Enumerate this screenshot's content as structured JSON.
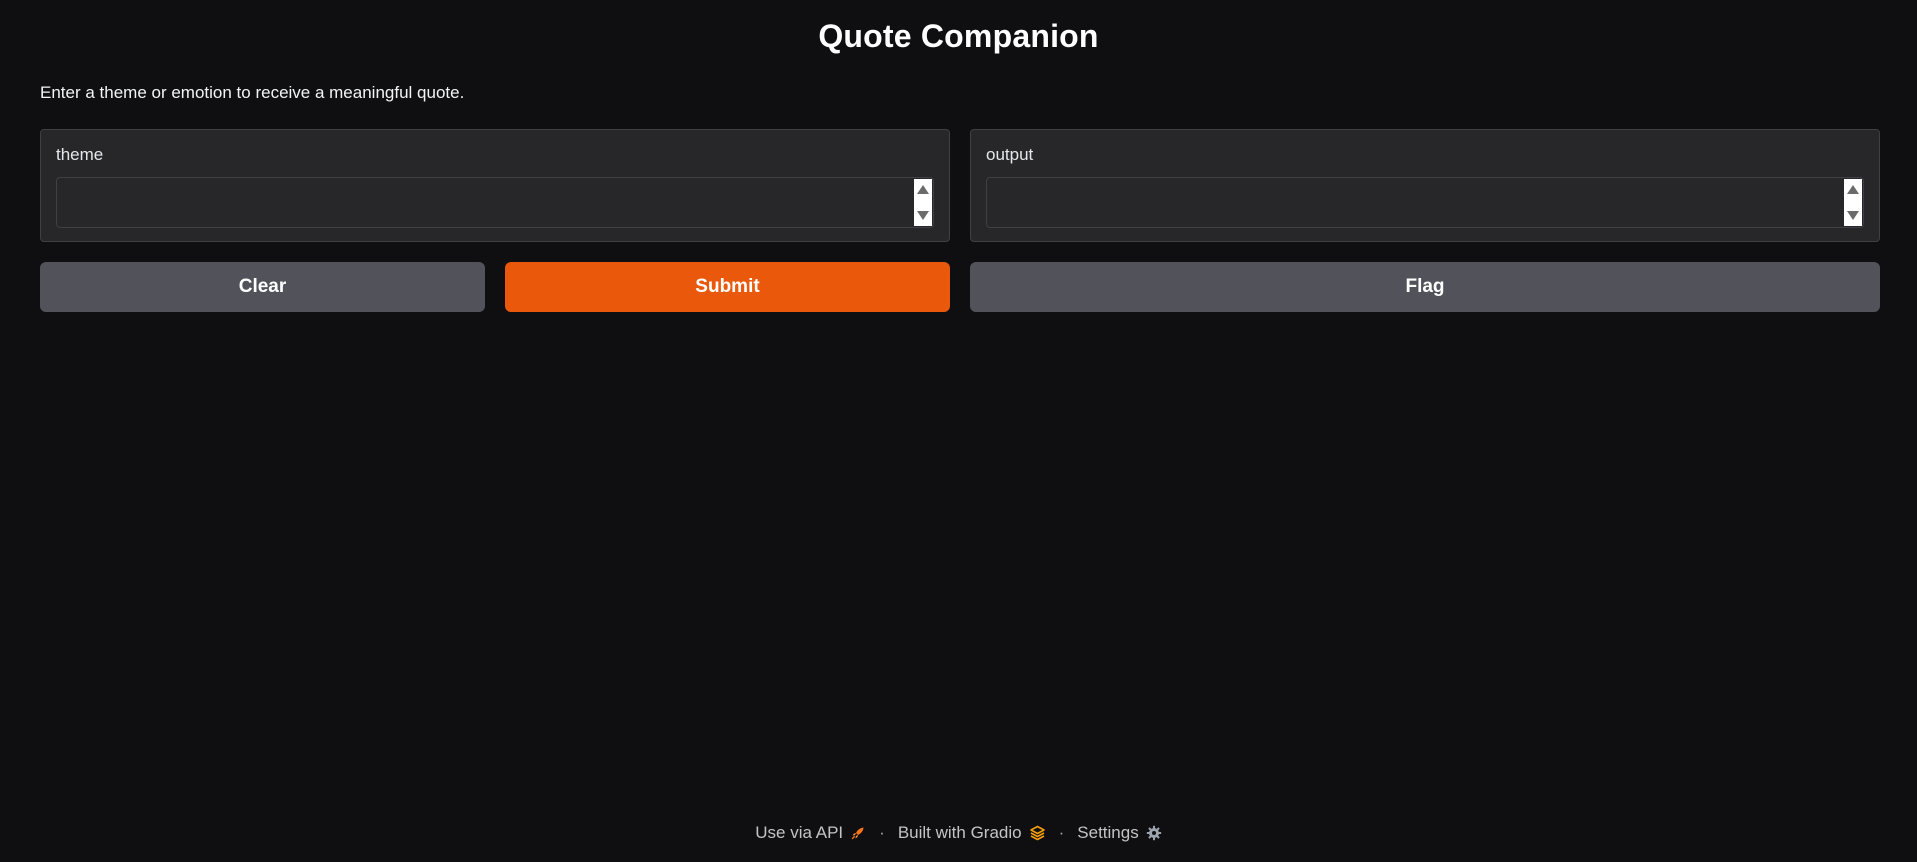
{
  "header": {
    "title": "Quote Companion",
    "description": "Enter a theme or emotion to receive a meaningful quote."
  },
  "inputs": {
    "theme": {
      "label": "theme",
      "value": ""
    },
    "output": {
      "label": "output",
      "value": ""
    }
  },
  "buttons": {
    "clear": "Clear",
    "submit": "Submit",
    "flag": "Flag"
  },
  "footer": {
    "api": "Use via API",
    "built": "Built with Gradio",
    "settings": "Settings",
    "separator": "·"
  },
  "colors": {
    "background": "#0f0f11",
    "panel": "#27272a",
    "primary": "#ea580c",
    "secondary": "#52525b"
  },
  "icons": {
    "api": "rocket-icon",
    "gradio": "gradio-logo-icon",
    "settings": "gear-icon"
  }
}
